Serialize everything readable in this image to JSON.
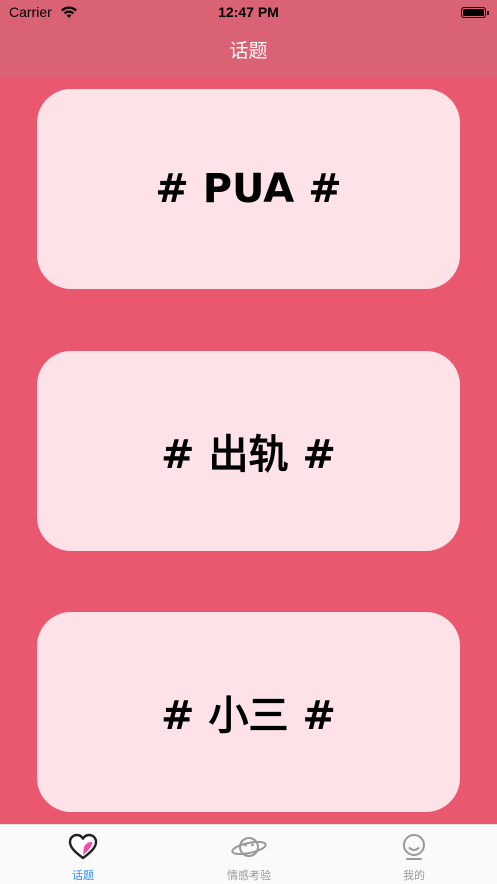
{
  "status_bar": {
    "carrier": "Carrier",
    "time": "12:47 PM"
  },
  "nav": {
    "title": "话题"
  },
  "topics": [
    {
      "label": "# PUA #"
    },
    {
      "label": "# 出轨 #"
    },
    {
      "label": "# 小三 #"
    }
  ],
  "tabs": [
    {
      "label": "话题",
      "icon": "heart-icon",
      "active": true
    },
    {
      "label": "情感考验",
      "icon": "planet-icon",
      "active": false
    },
    {
      "label": "我的",
      "icon": "smiley-icon",
      "active": false
    }
  ],
  "colors": {
    "background": "#ea5870",
    "header": "#d96374",
    "card": "#fde3e7",
    "active_tab": "#2f8ff6",
    "inactive_tab": "#999999"
  }
}
